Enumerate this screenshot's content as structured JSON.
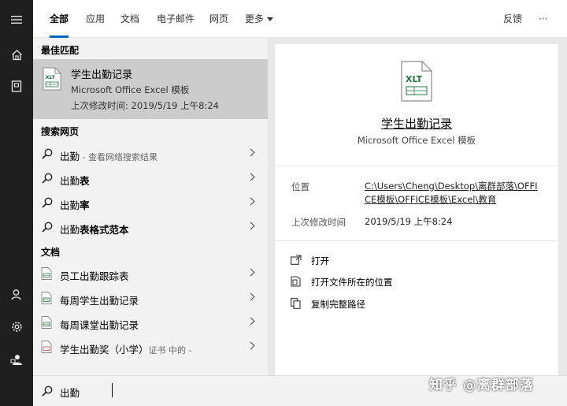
{
  "tabs": [
    "全部",
    "应用",
    "文档",
    "电子邮件",
    "网页",
    "更多"
  ],
  "topbar": {
    "feedback": "反馈",
    "more_dots": "···"
  },
  "sections": {
    "best_match": "最佳匹配",
    "search_web": "搜索网页",
    "documents": "文档"
  },
  "best_match": {
    "title": "学生出勤记录",
    "type": "Microsoft Office Excel 模板",
    "modified": "上次修改时间: 2019/5/19 上午8:24",
    "icon_label": "XLT"
  },
  "web_results": [
    {
      "prefix": "出勤",
      "bold": "",
      "suffix": " - 查看网络搜索结果"
    },
    {
      "prefix": "出勤",
      "bold": "表",
      "suffix": ""
    },
    {
      "prefix": "出勤",
      "bold": "率",
      "suffix": ""
    },
    {
      "prefix": "出勤",
      "bold": "表格式范本",
      "suffix": ""
    }
  ],
  "documents": [
    {
      "label": "员工出勤跟踪表",
      "suffix": ""
    },
    {
      "label": "每周学生出勤记录",
      "suffix": ""
    },
    {
      "label": "每周课堂出勤记录",
      "suffix": ""
    },
    {
      "label": "学生出勤奖（小学）",
      "suffix": "证书 中的 -"
    }
  ],
  "search": {
    "value": "出勤"
  },
  "preview": {
    "icon_label": "XLT",
    "title": "学生出勤记录",
    "type": "Microsoft Office Excel 模板",
    "location_label": "位置",
    "location_value": "C:\\Users\\Cheng\\Desktop\\离群部落\\OFFICE模板\\OFFICE模板\\Excel\\教育",
    "modified_label": "上次修改时间",
    "modified_value": "2019/5/19 上午8:24",
    "actions": [
      "打开",
      "打开文件所在的位置",
      "复制完整路径"
    ]
  },
  "watermark": "知乎 @离群部落",
  "colors": {
    "accent": "#0067c0",
    "rail": "#1f1f1f",
    "selected": "#cccccc"
  }
}
